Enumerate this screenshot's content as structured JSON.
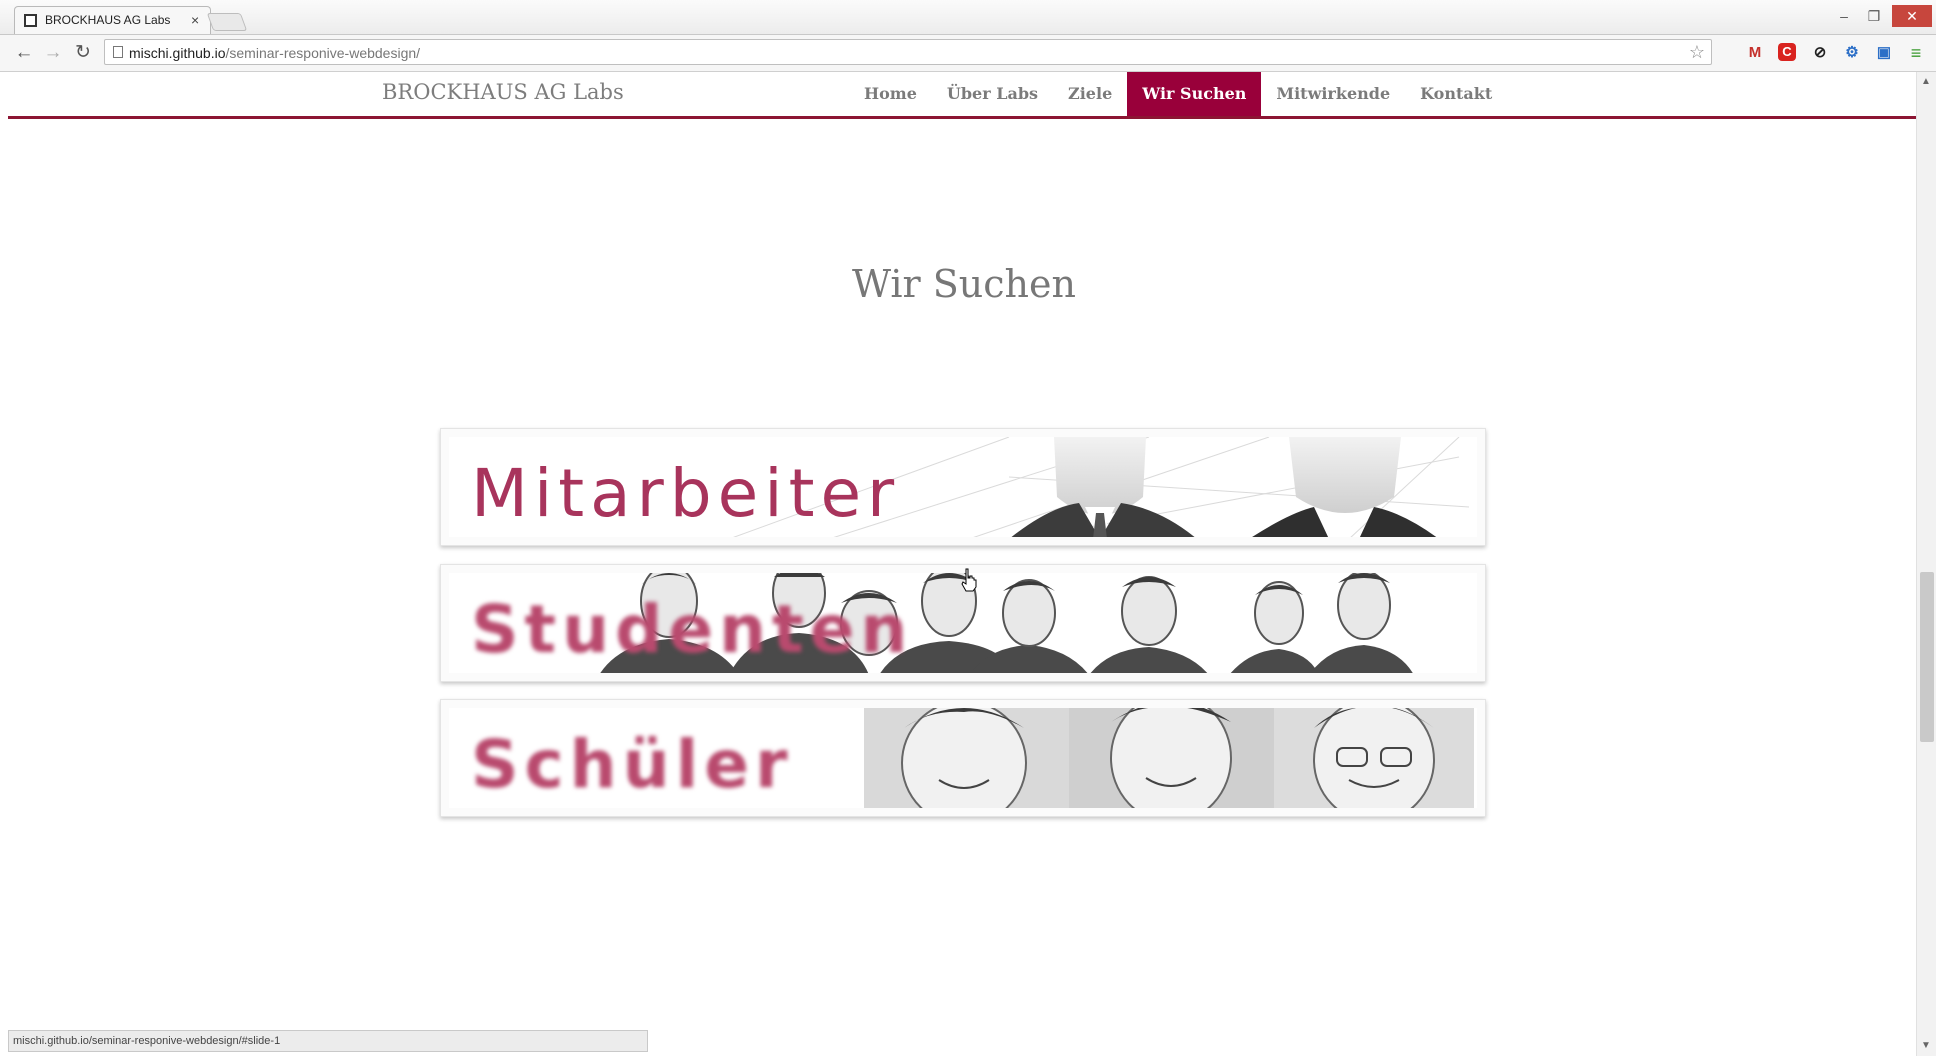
{
  "browser": {
    "tab_title": "BROCKHAUS AG Labs",
    "tab_close": "×",
    "url_host": "mischi.github.io",
    "url_path": "/seminar-responive-webdesign/",
    "status_text": "mischi.github.io/seminar-responive-webdesign/#slide-1",
    "window_controls": {
      "minimize": "–",
      "maximize": "❐",
      "close": "✕"
    },
    "nav_glyphs": {
      "back": "←",
      "forward": "→",
      "reload": "↻",
      "star": "☆"
    },
    "extensions": [
      "M",
      "C",
      "⊘",
      "⚙",
      "▣",
      "≡"
    ]
  },
  "site": {
    "brand": "BROCKHAUS AG Labs",
    "nav": [
      {
        "label": "Home",
        "active": false
      },
      {
        "label": "Über Labs",
        "active": false
      },
      {
        "label": "Ziele",
        "active": false
      },
      {
        "label": "Wir Suchen",
        "active": true
      },
      {
        "label": "Mitwirkende",
        "active": false
      },
      {
        "label": "Kontakt",
        "active": false
      }
    ],
    "accent_color": "#99003a"
  },
  "section": {
    "title": "Wir Suchen",
    "banners": [
      {
        "label": "Mitarbeiter",
        "image": "silhouette-people"
      },
      {
        "label": "Studenten",
        "image": "student-group-photo"
      },
      {
        "label": "Schüler",
        "image": "pupil-portraits"
      }
    ]
  }
}
